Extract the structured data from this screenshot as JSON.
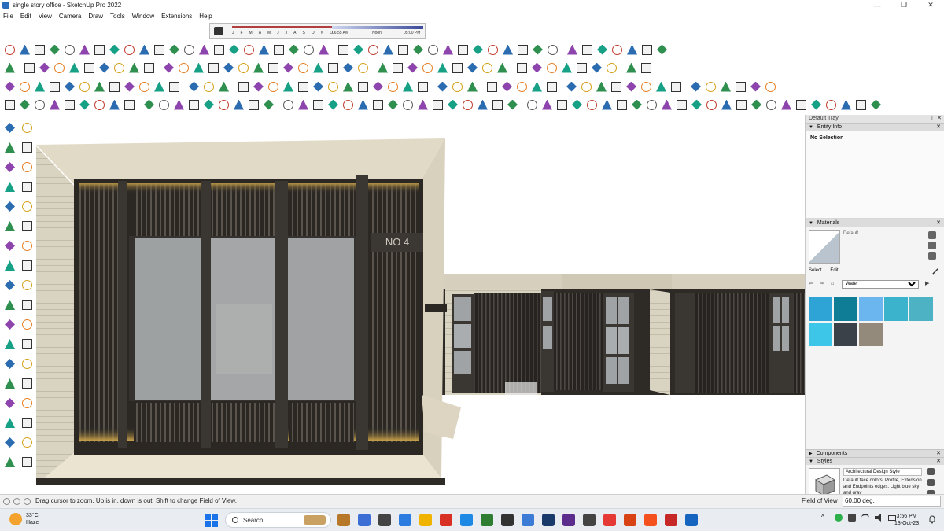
{
  "window": {
    "title": "single story office - SketchUp Pro 2022",
    "controls": {
      "minimize": "—",
      "maximize": "❐",
      "close": "✕"
    }
  },
  "menu": [
    "File",
    "Edit",
    "View",
    "Camera",
    "Draw",
    "Tools",
    "Window",
    "Extensions",
    "Help"
  ],
  "shadow": {
    "months": [
      "J",
      "F",
      "M",
      "A",
      "M",
      "J",
      "J",
      "A",
      "S",
      "O",
      "N",
      "D"
    ],
    "time_start": "06:55 AM",
    "time_mid": "Noon",
    "time_end": "05:00 PM"
  },
  "model": {
    "plate_text": "NO 4"
  },
  "tray": {
    "title": "Default Tray",
    "pin": "⊤",
    "close": "✕",
    "entity_info": {
      "header": "Entity Info",
      "selection": "No Selection"
    },
    "materials": {
      "header": "Materials",
      "current": "Default",
      "tabs": [
        "Select",
        "Edit"
      ],
      "collection": "Water",
      "swatches": [
        "#2da3d6",
        "#0f7d95",
        "#6cb6f0",
        "#3cb3cc",
        "#4db2c4",
        "#3ec6e8",
        "#3b4148",
        "#948a7c"
      ]
    },
    "components": {
      "header": "Components"
    },
    "styles": {
      "header": "Styles",
      "name": "Architectural Design Style",
      "description": "Default face colors. Profile, Extension and Endpoints edges. Light blue sky and gray"
    }
  },
  "status": {
    "message": "Drag cursor to zoom.  Up is in, down is out. Shift to change Field of View.",
    "fov_label": "Field of View",
    "fov_value": "60.00 deg."
  },
  "taskbar": {
    "temperature": "33°C",
    "condition": "Haze",
    "search_label": "Search",
    "time": "3:56 PM",
    "date": "13-Oct-23"
  },
  "colors": {
    "accent": "#1a73e8",
    "building_dark": "#3a3632",
    "building_cream": "#e7e0cc",
    "glass": "#a0a3a4"
  }
}
